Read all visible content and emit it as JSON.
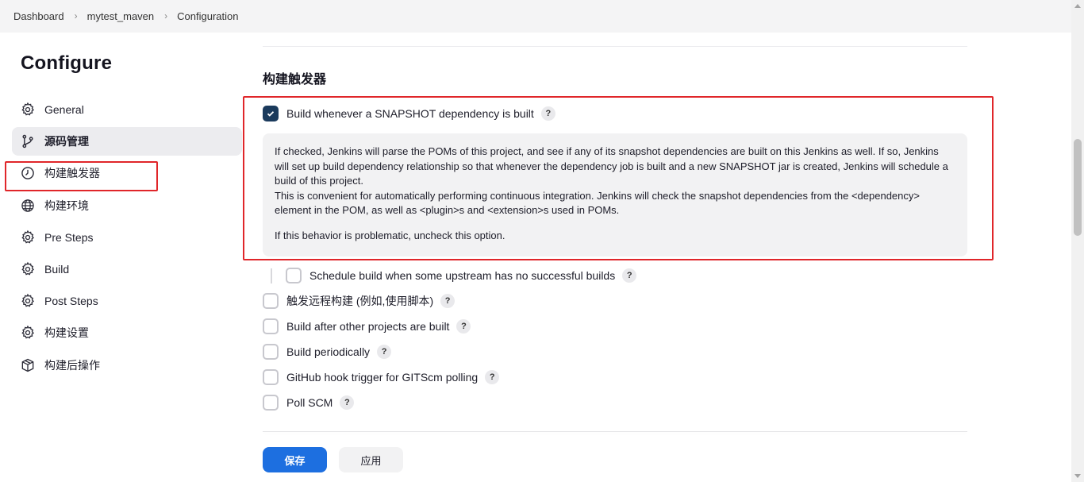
{
  "breadcrumb": [
    "Dashboard",
    "mytest_maven",
    "Configuration"
  ],
  "sidebar": {
    "title": "Configure",
    "items": [
      {
        "label": "General",
        "icon": "gear-icon"
      },
      {
        "label": "源码管理",
        "icon": "branch-icon"
      },
      {
        "label": "构建触发器",
        "icon": "clock-icon"
      },
      {
        "label": "构建环境",
        "icon": "globe-icon"
      },
      {
        "label": "Pre Steps",
        "icon": "gear-icon"
      },
      {
        "label": "Build",
        "icon": "gear-icon"
      },
      {
        "label": "Post Steps",
        "icon": "gear-icon"
      },
      {
        "label": "构建设置",
        "icon": "gear-icon"
      },
      {
        "label": "构建后操作",
        "icon": "package-icon"
      }
    ]
  },
  "section": {
    "title": "构建触发器",
    "snapshot": {
      "label": "Build whenever a SNAPSHOT dependency is built",
      "checked": true,
      "help": [
        "If checked, Jenkins will parse the POMs of this project, and see if any of its snapshot dependencies are built on this Jenkins as well. If so, Jenkins will set up build dependency relationship so that whenever the dependency job is built and a new SNAPSHOT jar is created, Jenkins will schedule a build of this project.",
        "This is convenient for automatically performing continuous integration. Jenkins will check the snapshot dependencies from the <dependency> element in the POM, as well as <plugin>s and <extension>s used in POMs.",
        "If this behavior is problematic, uncheck this option."
      ]
    },
    "upstream": {
      "label": "Schedule build when some upstream has no successful builds",
      "checked": false
    },
    "options": [
      {
        "label": "触发远程构建 (例如,使用脚本)",
        "checked": false
      },
      {
        "label": "Build after other projects are built",
        "checked": false
      },
      {
        "label": "Build periodically",
        "checked": false
      },
      {
        "label": "GitHub hook trigger for GITScm polling",
        "checked": false
      },
      {
        "label": "Poll SCM",
        "checked": false
      }
    ],
    "help_glyph": "?"
  },
  "buttons": {
    "save": "保存",
    "apply": "应用"
  },
  "colors": {
    "primary": "#1d6fe0",
    "checkbox_checked": "#1a3a5c",
    "highlight": "#e0262a"
  }
}
